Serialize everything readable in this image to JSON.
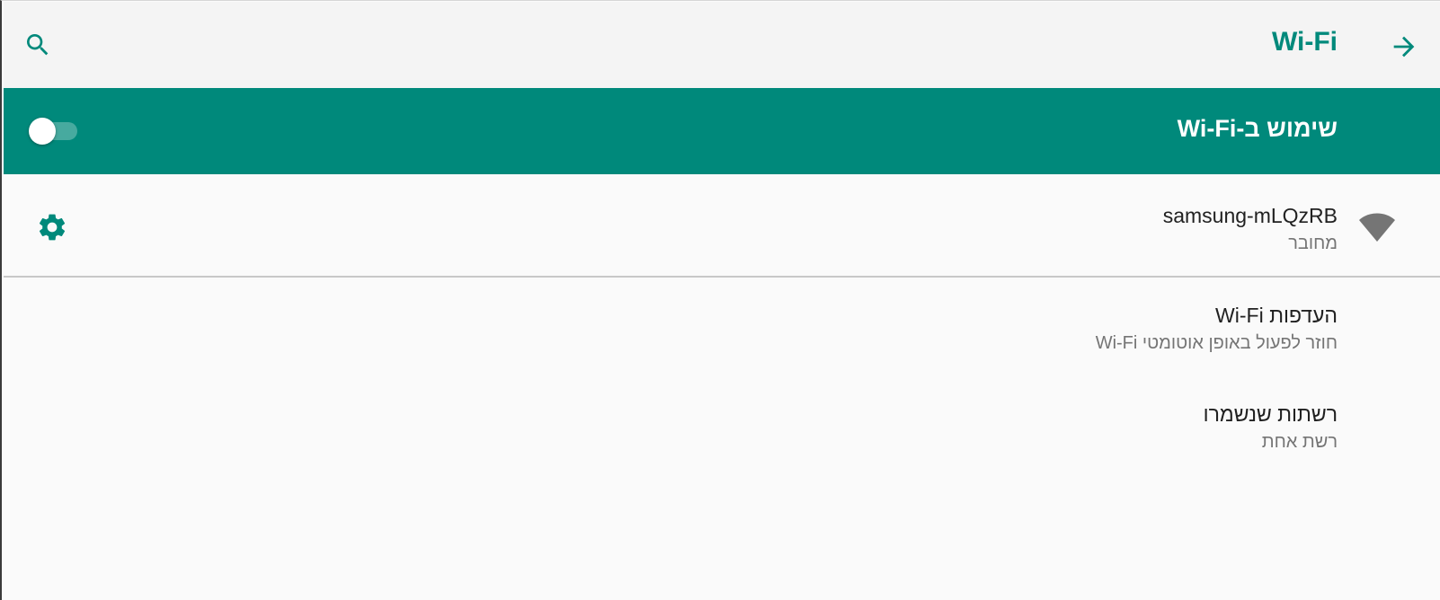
{
  "toolbar": {
    "title": "Wi-Fi",
    "search_icon": "search-icon",
    "back_icon": "arrow-forward-icon"
  },
  "master_switch": {
    "label": "שימוש ב-Wi-Fi",
    "state": "on"
  },
  "networks": [
    {
      "ssid": "samsung-mLQzRB",
      "status": "מחובר",
      "signal_icon": "wifi-signal-icon",
      "settings_icon": "gear-icon"
    }
  ],
  "preferences": [
    {
      "title": "העדפות Wi-Fi",
      "summary": "Wi-Fi חוזר לפעול באופן אוטומטי"
    },
    {
      "title": "רשתות שנשמרו",
      "summary": "רשת אחת"
    }
  ],
  "colors": {
    "accent": "#00897b",
    "toolbar_bg": "#f4f4f4",
    "page_bg": "#fafafa",
    "primary_text": "#212121",
    "secondary_text": "#757575",
    "wifi_icon": "#757575"
  }
}
